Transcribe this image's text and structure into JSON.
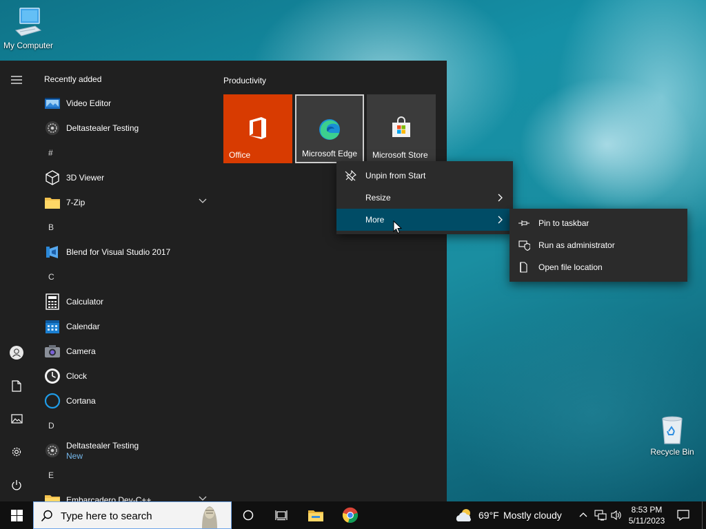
{
  "desktop": {
    "my_computer_label": "My Computer",
    "recycle_bin_label": "Recycle Bin"
  },
  "start_menu": {
    "list_header": "Recently added",
    "apps": [
      {
        "type": "app",
        "name": "Video Editor",
        "icon": "video-editor-icon"
      },
      {
        "type": "app",
        "name": "Deltastealer Testing",
        "icon": "gear-app-icon"
      },
      {
        "type": "letter",
        "name": "#"
      },
      {
        "type": "app",
        "name": "3D Viewer",
        "icon": "cube-icon"
      },
      {
        "type": "app",
        "name": "7-Zip",
        "icon": "folder-icon",
        "expandable": true
      },
      {
        "type": "letter",
        "name": "B"
      },
      {
        "type": "app",
        "name": "Blend for Visual Studio 2017",
        "icon": "blend-icon"
      },
      {
        "type": "letter",
        "name": "C"
      },
      {
        "type": "app",
        "name": "Calculator",
        "icon": "calculator-icon"
      },
      {
        "type": "app",
        "name": "Calendar",
        "icon": "calendar-icon"
      },
      {
        "type": "app",
        "name": "Camera",
        "icon": "camera-icon"
      },
      {
        "type": "app",
        "name": "Clock",
        "icon": "clock-icon"
      },
      {
        "type": "app",
        "name": "Cortana",
        "icon": "cortana-icon"
      },
      {
        "type": "letter",
        "name": "D"
      },
      {
        "type": "app",
        "name": "Deltastealer Testing",
        "icon": "gear-app-icon",
        "sub": "New"
      },
      {
        "type": "letter",
        "name": "E"
      },
      {
        "type": "app",
        "name": "Embarcadero Dev-C++",
        "icon": "folder-icon",
        "expandable": true
      }
    ],
    "tiles_group_title": "Productivity",
    "tiles": [
      {
        "label": "Office",
        "color": "#d83b01"
      },
      {
        "label": "Microsoft Edge",
        "color": "#3b3b3b"
      },
      {
        "label": "Microsoft Store",
        "color": "#3b3b3b"
      }
    ]
  },
  "context_menu": {
    "items": [
      {
        "label": "Unpin from Start",
        "icon": "unpin-icon"
      },
      {
        "label": "Resize",
        "has_submenu": true
      },
      {
        "label": "More",
        "has_submenu": true,
        "highlighted": true
      }
    ]
  },
  "submenu": {
    "items": [
      {
        "label": "Pin to taskbar",
        "icon": "pin-icon"
      },
      {
        "label": "Run as administrator",
        "icon": "shield-icon"
      },
      {
        "label": "Open file location",
        "icon": "file-location-icon"
      }
    ]
  },
  "taskbar": {
    "search_placeholder": "Type here to search",
    "weather_temp": "69°F",
    "weather_condition": "Mostly cloudy",
    "time": "8:53 PM",
    "date": "5/11/2023"
  },
  "colors": {
    "accent": "#0078d4",
    "highlight": "#004c66",
    "office_tile": "#d83b01",
    "start_bg": "#202020",
    "taskbar_bg": "#101010"
  }
}
